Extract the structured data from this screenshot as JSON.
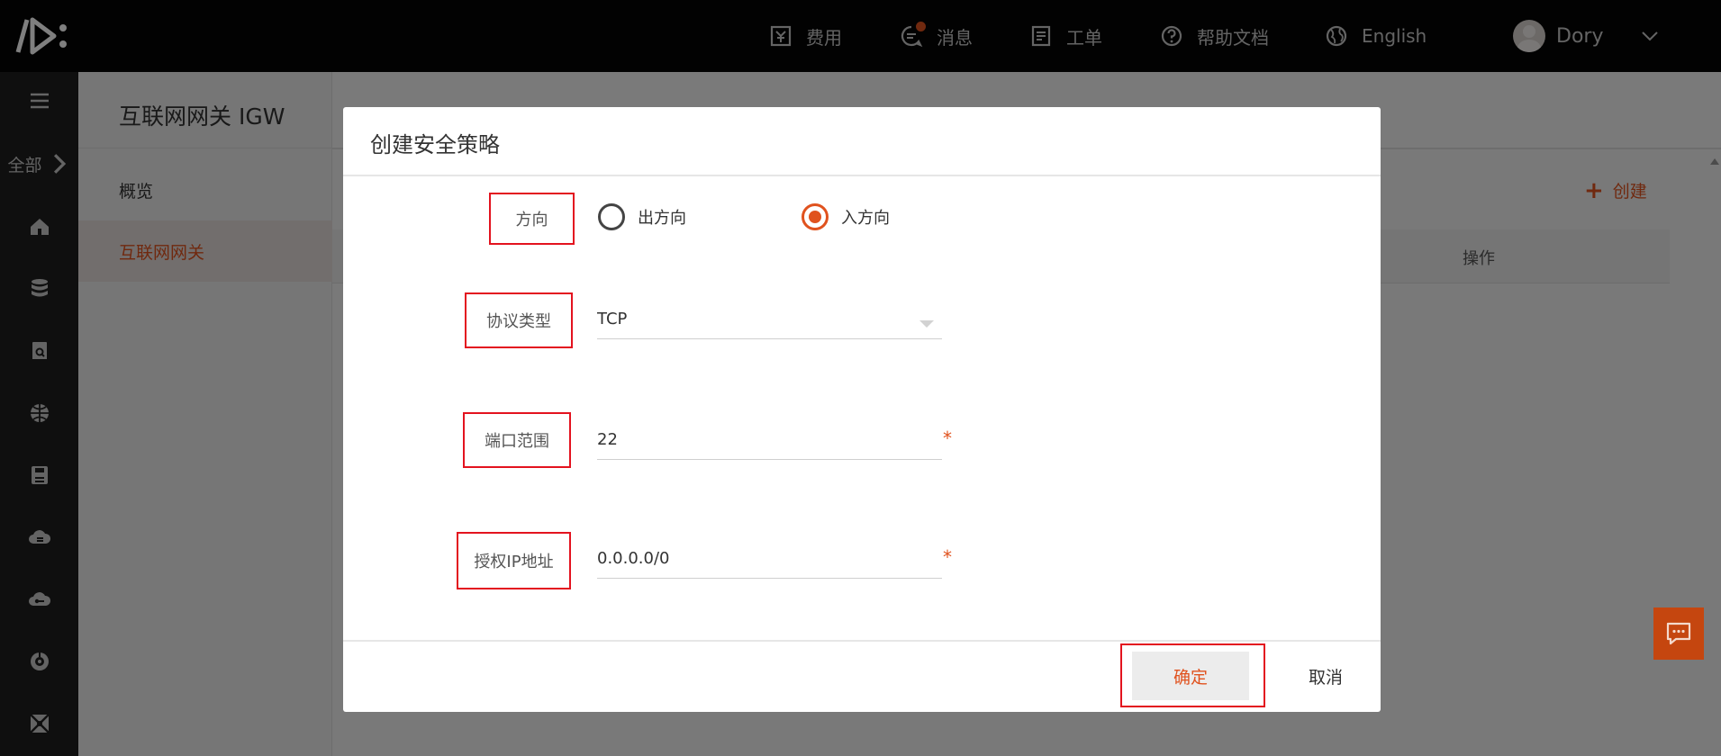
{
  "topbar": {
    "items": [
      {
        "label": "费用",
        "icon": "billing-icon"
      },
      {
        "label": "消息",
        "icon": "message-icon",
        "has_notification": true
      },
      {
        "label": "工单",
        "icon": "ticket-icon"
      },
      {
        "label": "帮助文档",
        "icon": "help-icon"
      },
      {
        "label": "English",
        "icon": "globe-icon"
      }
    ],
    "user": {
      "name": "Dory"
    }
  },
  "rail": {
    "all_label": "全部",
    "icons": [
      "home-icon",
      "database-icon",
      "storage-icon",
      "network-icon",
      "disk-icon",
      "cloud-icon",
      "cloud-key-icon",
      "monitor-icon",
      "apps-icon"
    ]
  },
  "subnav": {
    "title": "互联网网关 IGW",
    "items": [
      {
        "label": "概览",
        "active": false
      },
      {
        "label": "互联网网关",
        "active": true
      }
    ]
  },
  "content": {
    "create_label": "创建",
    "table_op_header": "操作"
  },
  "modal": {
    "title": "创建安全策略",
    "direction": {
      "label": "方向",
      "options": [
        {
          "label": "出方向",
          "checked": false
        },
        {
          "label": "入方向",
          "checked": true
        }
      ]
    },
    "protocol": {
      "label": "协议类型",
      "value": "TCP"
    },
    "port": {
      "label": "端口范围",
      "value": "22",
      "required_mark": "*"
    },
    "ip": {
      "label": "授权IP地址",
      "value": "0.0.0.0/0",
      "required_mark": "*"
    },
    "confirm_label": "确定",
    "cancel_label": "取消"
  },
  "colors": {
    "accent": "#e0521e",
    "highlight_box": "#e3131f",
    "topbar_bg": "#050505",
    "rail_bg": "#1e1e1e"
  }
}
